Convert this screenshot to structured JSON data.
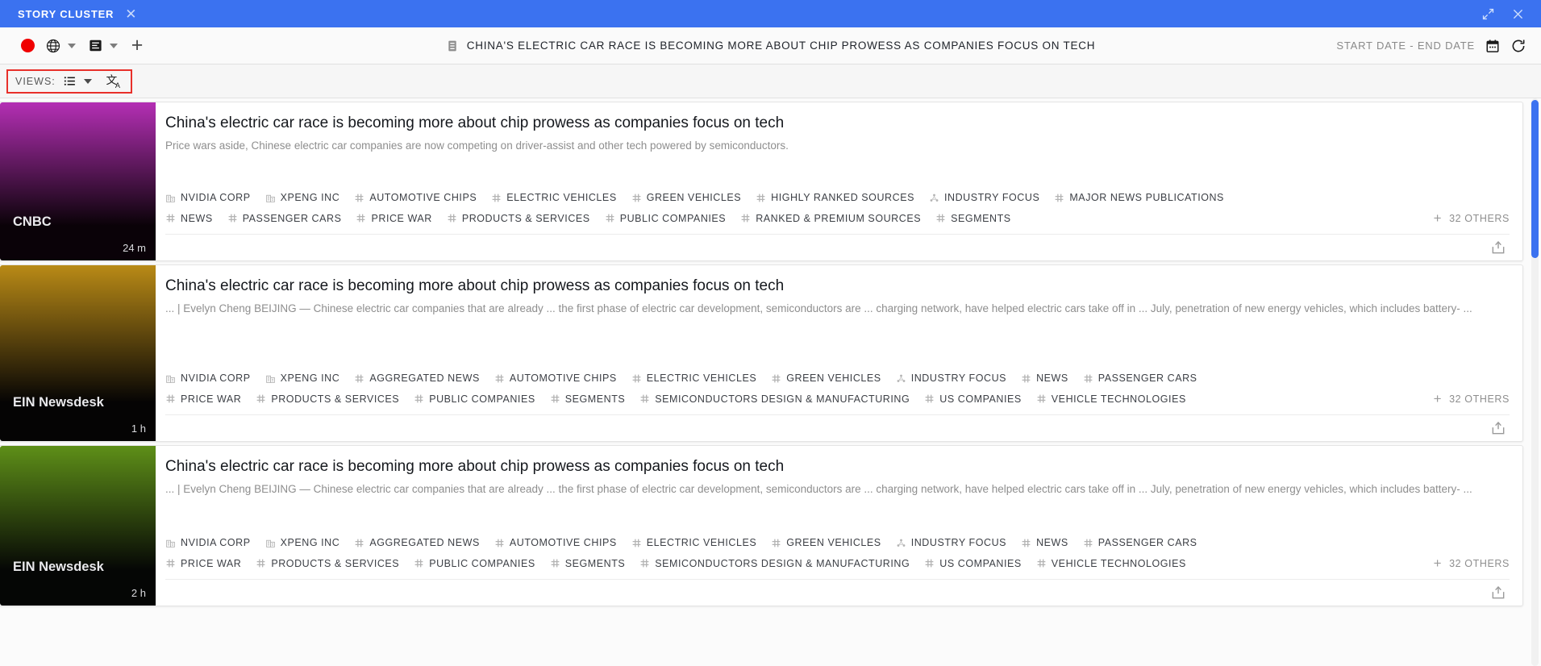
{
  "titlebar": {
    "tab_label": "STORY CLUSTER",
    "close_icon": "close-icon",
    "expand_icon": "expand-icon",
    "window_close_icon": "close-icon",
    "accent_color": "#3b72f0"
  },
  "toolbar": {
    "record_icon": "record-dot-icon",
    "globe_icon": "globe-icon",
    "article_icon": "article-icon",
    "add_icon": "plus-icon",
    "doc_icon": "document-icon",
    "doc_title": "CHINA'S ELECTRIC CAR RACE IS BECOMING MORE ABOUT CHIP PROWESS AS COMPANIES FOCUS ON TECH",
    "date_range": "START DATE - END DATE",
    "calendar_icon": "calendar-icon",
    "refresh_icon": "refresh-icon"
  },
  "viewsbar": {
    "label": "VIEWS:",
    "list_icon": "list-view-icon",
    "caret_icon": "chevron-down-icon",
    "translate_icon": "translate-icon",
    "highlight_color": "#e8302a"
  },
  "cards": [
    {
      "source": "CNBC",
      "time": "24 m",
      "thumb_from": "#b42fb4",
      "thumb_to": "#0a0208",
      "title": "China's electric car race is becoming more about chip prowess as companies focus on tech",
      "description": "Price wars aside, Chinese electric car companies are now competing on driver-assist and other tech powered by semiconductors.",
      "others": "32 OTHERS",
      "share_icon": "share-icon",
      "tag_rows": [
        [
          {
            "icon": "company-icon",
            "label": "NVIDIA CORP"
          },
          {
            "icon": "company-icon",
            "label": "XPENG INC"
          },
          {
            "icon": "hash-icon",
            "label": "AUTOMOTIVE CHIPS"
          },
          {
            "icon": "hash-icon",
            "label": "ELECTRIC VEHICLES"
          },
          {
            "icon": "hash-icon",
            "label": "GREEN VEHICLES"
          },
          {
            "icon": "hash-icon",
            "label": "HIGHLY RANKED SOURCES"
          },
          {
            "icon": "topic-icon",
            "label": "INDUSTRY FOCUS"
          },
          {
            "icon": "hash-icon",
            "label": "MAJOR NEWS PUBLICATIONS"
          }
        ],
        [
          {
            "icon": "hash-icon",
            "label": "NEWS"
          },
          {
            "icon": "hash-icon",
            "label": "PASSENGER CARS"
          },
          {
            "icon": "hash-icon",
            "label": "PRICE WAR"
          },
          {
            "icon": "hash-icon",
            "label": "PRODUCTS & SERVICES"
          },
          {
            "icon": "hash-icon",
            "label": "PUBLIC COMPANIES"
          },
          {
            "icon": "hash-icon",
            "label": "RANKED & PREMIUM SOURCES"
          },
          {
            "icon": "hash-icon",
            "label": "SEGMENTS"
          }
        ]
      ]
    },
    {
      "source": "EIN Newsdesk",
      "time": "1 h",
      "thumb_from": "#b98a16",
      "thumb_to": "#050404",
      "title": "China's electric car race is becoming more about chip prowess as companies focus on tech",
      "description": "... | Evelyn Cheng BEIJING — Chinese electric car companies that are already ... the first phase of electric car development, semiconductors are ... charging network, have helped electric cars take off in ... July, penetration of new energy vehicles, which includes battery- ...",
      "others": "32 OTHERS",
      "share_icon": "share-icon",
      "tag_rows": [
        [
          {
            "icon": "company-icon",
            "label": "NVIDIA CORP"
          },
          {
            "icon": "company-icon",
            "label": "XPENG INC"
          },
          {
            "icon": "hash-icon",
            "label": "AGGREGATED NEWS"
          },
          {
            "icon": "hash-icon",
            "label": "AUTOMOTIVE CHIPS"
          },
          {
            "icon": "hash-icon",
            "label": "ELECTRIC VEHICLES"
          },
          {
            "icon": "hash-icon",
            "label": "GREEN VEHICLES"
          },
          {
            "icon": "topic-icon",
            "label": "INDUSTRY FOCUS"
          },
          {
            "icon": "hash-icon",
            "label": "NEWS"
          },
          {
            "icon": "hash-icon",
            "label": "PASSENGER CARS"
          }
        ],
        [
          {
            "icon": "hash-icon",
            "label": "PRICE WAR"
          },
          {
            "icon": "hash-icon",
            "label": "PRODUCTS & SERVICES"
          },
          {
            "icon": "hash-icon",
            "label": "PUBLIC COMPANIES"
          },
          {
            "icon": "hash-icon",
            "label": "SEGMENTS"
          },
          {
            "icon": "hash-icon",
            "label": "SEMICONDUCTORS DESIGN & MANUFACTURING"
          },
          {
            "icon": "hash-icon",
            "label": "US COMPANIES"
          },
          {
            "icon": "hash-icon",
            "label": "VEHICLE TECHNOLOGIES"
          }
        ]
      ]
    },
    {
      "source": "EIN Newsdesk",
      "time": "2 h",
      "thumb_from": "#5e8f18",
      "thumb_to": "#050605",
      "title": "China's electric car race is becoming more about chip prowess as companies focus on tech",
      "description": "... | Evelyn Cheng BEIJING — Chinese electric car companies that are already ... the first phase of electric car development, semiconductors are ... charging network, have helped electric cars take off in ... July, penetration of new energy vehicles, which includes battery- ...",
      "others": "32 OTHERS",
      "share_icon": "share-icon",
      "tag_rows": [
        [
          {
            "icon": "company-icon",
            "label": "NVIDIA CORP"
          },
          {
            "icon": "company-icon",
            "label": "XPENG INC"
          },
          {
            "icon": "hash-icon",
            "label": "AGGREGATED NEWS"
          },
          {
            "icon": "hash-icon",
            "label": "AUTOMOTIVE CHIPS"
          },
          {
            "icon": "hash-icon",
            "label": "ELECTRIC VEHICLES"
          },
          {
            "icon": "hash-icon",
            "label": "GREEN VEHICLES"
          },
          {
            "icon": "topic-icon",
            "label": "INDUSTRY FOCUS"
          },
          {
            "icon": "hash-icon",
            "label": "NEWS"
          },
          {
            "icon": "hash-icon",
            "label": "PASSENGER CARS"
          }
        ],
        [
          {
            "icon": "hash-icon",
            "label": "PRICE WAR"
          },
          {
            "icon": "hash-icon",
            "label": "PRODUCTS & SERVICES"
          },
          {
            "icon": "hash-icon",
            "label": "PUBLIC COMPANIES"
          },
          {
            "icon": "hash-icon",
            "label": "SEGMENTS"
          },
          {
            "icon": "hash-icon",
            "label": "SEMICONDUCTORS DESIGN & MANUFACTURING"
          },
          {
            "icon": "hash-icon",
            "label": "US COMPANIES"
          },
          {
            "icon": "hash-icon",
            "label": "VEHICLE TECHNOLOGIES"
          }
        ]
      ]
    }
  ]
}
